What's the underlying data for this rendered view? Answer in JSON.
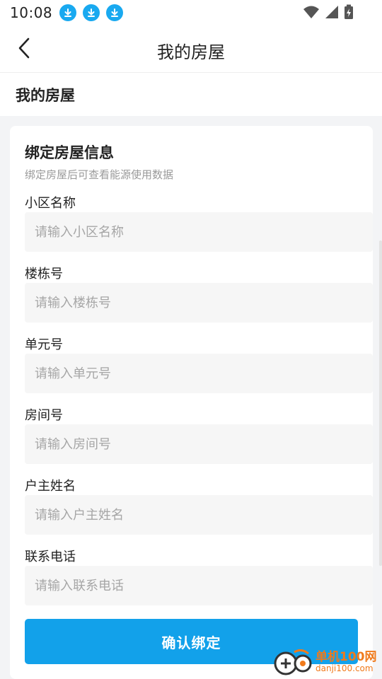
{
  "status_bar": {
    "time": "10:08",
    "icons": [
      "download-icon",
      "download-icon",
      "download-icon",
      "wifi-icon",
      "signal-icon",
      "battery-icon"
    ]
  },
  "nav": {
    "title": "我的房屋",
    "back_icon": "chevron-left-icon"
  },
  "section": {
    "title": "我的房屋"
  },
  "card": {
    "title": "绑定房屋信息",
    "subtitle": "绑定房屋后可查看能源使用数据",
    "fields": [
      {
        "label": "小区名称",
        "placeholder": "请输入小区名称",
        "value": ""
      },
      {
        "label": "楼栋号",
        "placeholder": "请输入楼栋号",
        "value": ""
      },
      {
        "label": "单元号",
        "placeholder": "请输入单元号",
        "value": ""
      },
      {
        "label": "房间号",
        "placeholder": "请输入房间号",
        "value": ""
      },
      {
        "label": "户主姓名",
        "placeholder": "请输入户主姓名",
        "value": ""
      },
      {
        "label": "联系电话",
        "placeholder": "请输入联系电话",
        "value": ""
      }
    ],
    "submit_label": "确认绑定"
  },
  "watermark": {
    "line1": "单机100网",
    "line2": "danji100.com"
  },
  "colors": {
    "accent": "#12a1ea",
    "download_badge": "#19a9f0",
    "input_bg": "#f6f6f6",
    "watermark": "#f07a1b"
  }
}
